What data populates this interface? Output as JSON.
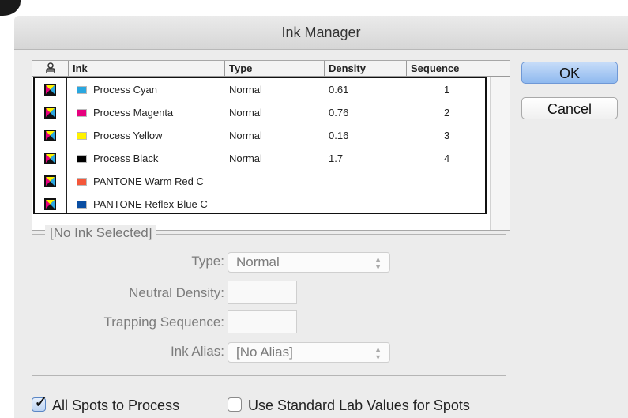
{
  "window": {
    "title": "Ink Manager"
  },
  "inklist": {
    "headers": {
      "icon": "person-icon",
      "ink": "Ink",
      "type": "Type",
      "density": "Density",
      "sequence": "Sequence"
    },
    "rows": [
      {
        "name": "Process Cyan",
        "swatch": "#2aa7e0",
        "type": "Normal",
        "density": "0.61",
        "sequence": "1"
      },
      {
        "name": "Process Magenta",
        "swatch": "#e6007e",
        "type": "Normal",
        "density": "0.76",
        "sequence": "2"
      },
      {
        "name": "Process Yellow",
        "swatch": "#fff200",
        "type": "Normal",
        "density": "0.16",
        "sequence": "3"
      },
      {
        "name": "Process Black",
        "swatch": "#000000",
        "type": "Normal",
        "density": "1.7",
        "sequence": "4"
      },
      {
        "name": "PANTONE Warm Red C",
        "swatch": "#f4573a",
        "type": "",
        "density": "",
        "sequence": ""
      },
      {
        "name": "PANTONE Reflex Blue C",
        "swatch": "#0a4ea2",
        "type": "",
        "density": "",
        "sequence": ""
      }
    ]
  },
  "buttons": {
    "ok": "OK",
    "cancel": "Cancel"
  },
  "details": {
    "title": "[No Ink Selected]",
    "type_label": "Type:",
    "type_value": "Normal",
    "neutral_density_label": "Neutral Density:",
    "trapping_sequence_label": "Trapping Sequence:",
    "ink_alias_label": "Ink Alias:",
    "ink_alias_value": "[No Alias]"
  },
  "options": {
    "all_spots": {
      "label": "All Spots to Process",
      "checked": true
    },
    "std_lab": {
      "label": "Use Standard Lab Values for Spots",
      "checked": false
    }
  }
}
